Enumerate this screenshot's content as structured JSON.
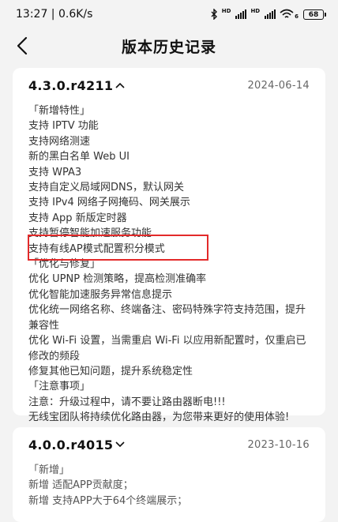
{
  "status_bar": {
    "time_speed": "13:27 | 0.6K/s",
    "signal1_label": "HD",
    "signal2_label": "HD",
    "wifi_label": "6",
    "battery": "68"
  },
  "nav": {
    "title": "版本历史记录"
  },
  "versions": [
    {
      "version": "4.3.0.r4211",
      "date": "2024-06-14",
      "expanded": true,
      "notes": [
        "「新增特性」",
        "支持 IPTV 功能",
        "支持网络测速",
        "新的黑白名单 Web UI",
        "支持 WPA3",
        "支持自定义局域网DNS，默认网关",
        "支持 IPv4 网络子网掩码、网关展示",
        "支持 App 新版定时器",
        "支持暂停智能加速服务功能",
        "支持有线AP模式配置积分模式",
        "「优化与修复」",
        "优化 UPNP 检测策略，提高检测准确率",
        "优化智能加速服务异常信息提示",
        "优化统一网络名称、终端备注、密码特殊字符支持范围，提升兼容性",
        "优化 Wi-Fi 设置，当需重启 Wi-Fi 以应用新配置时，仅重启已修改的频段",
        "修复其他已知问题，提升系统稳定性",
        "「注意事项」",
        "注意：升级过程中，请不要让路由器断电!!!",
        "无线宝团队将持续优化路由器，为您带来更好的使用体验!"
      ]
    },
    {
      "version": "4.0.0.r4015",
      "date": "2023-10-16",
      "expanded": false,
      "notes": [
        "「新增」",
        "新增 适配APP贡献度；",
        "新增 支持APP大于64个终端展示；"
      ]
    }
  ],
  "colors": {
    "highlight": "#e32a2a",
    "background": "#f3f3f3"
  }
}
